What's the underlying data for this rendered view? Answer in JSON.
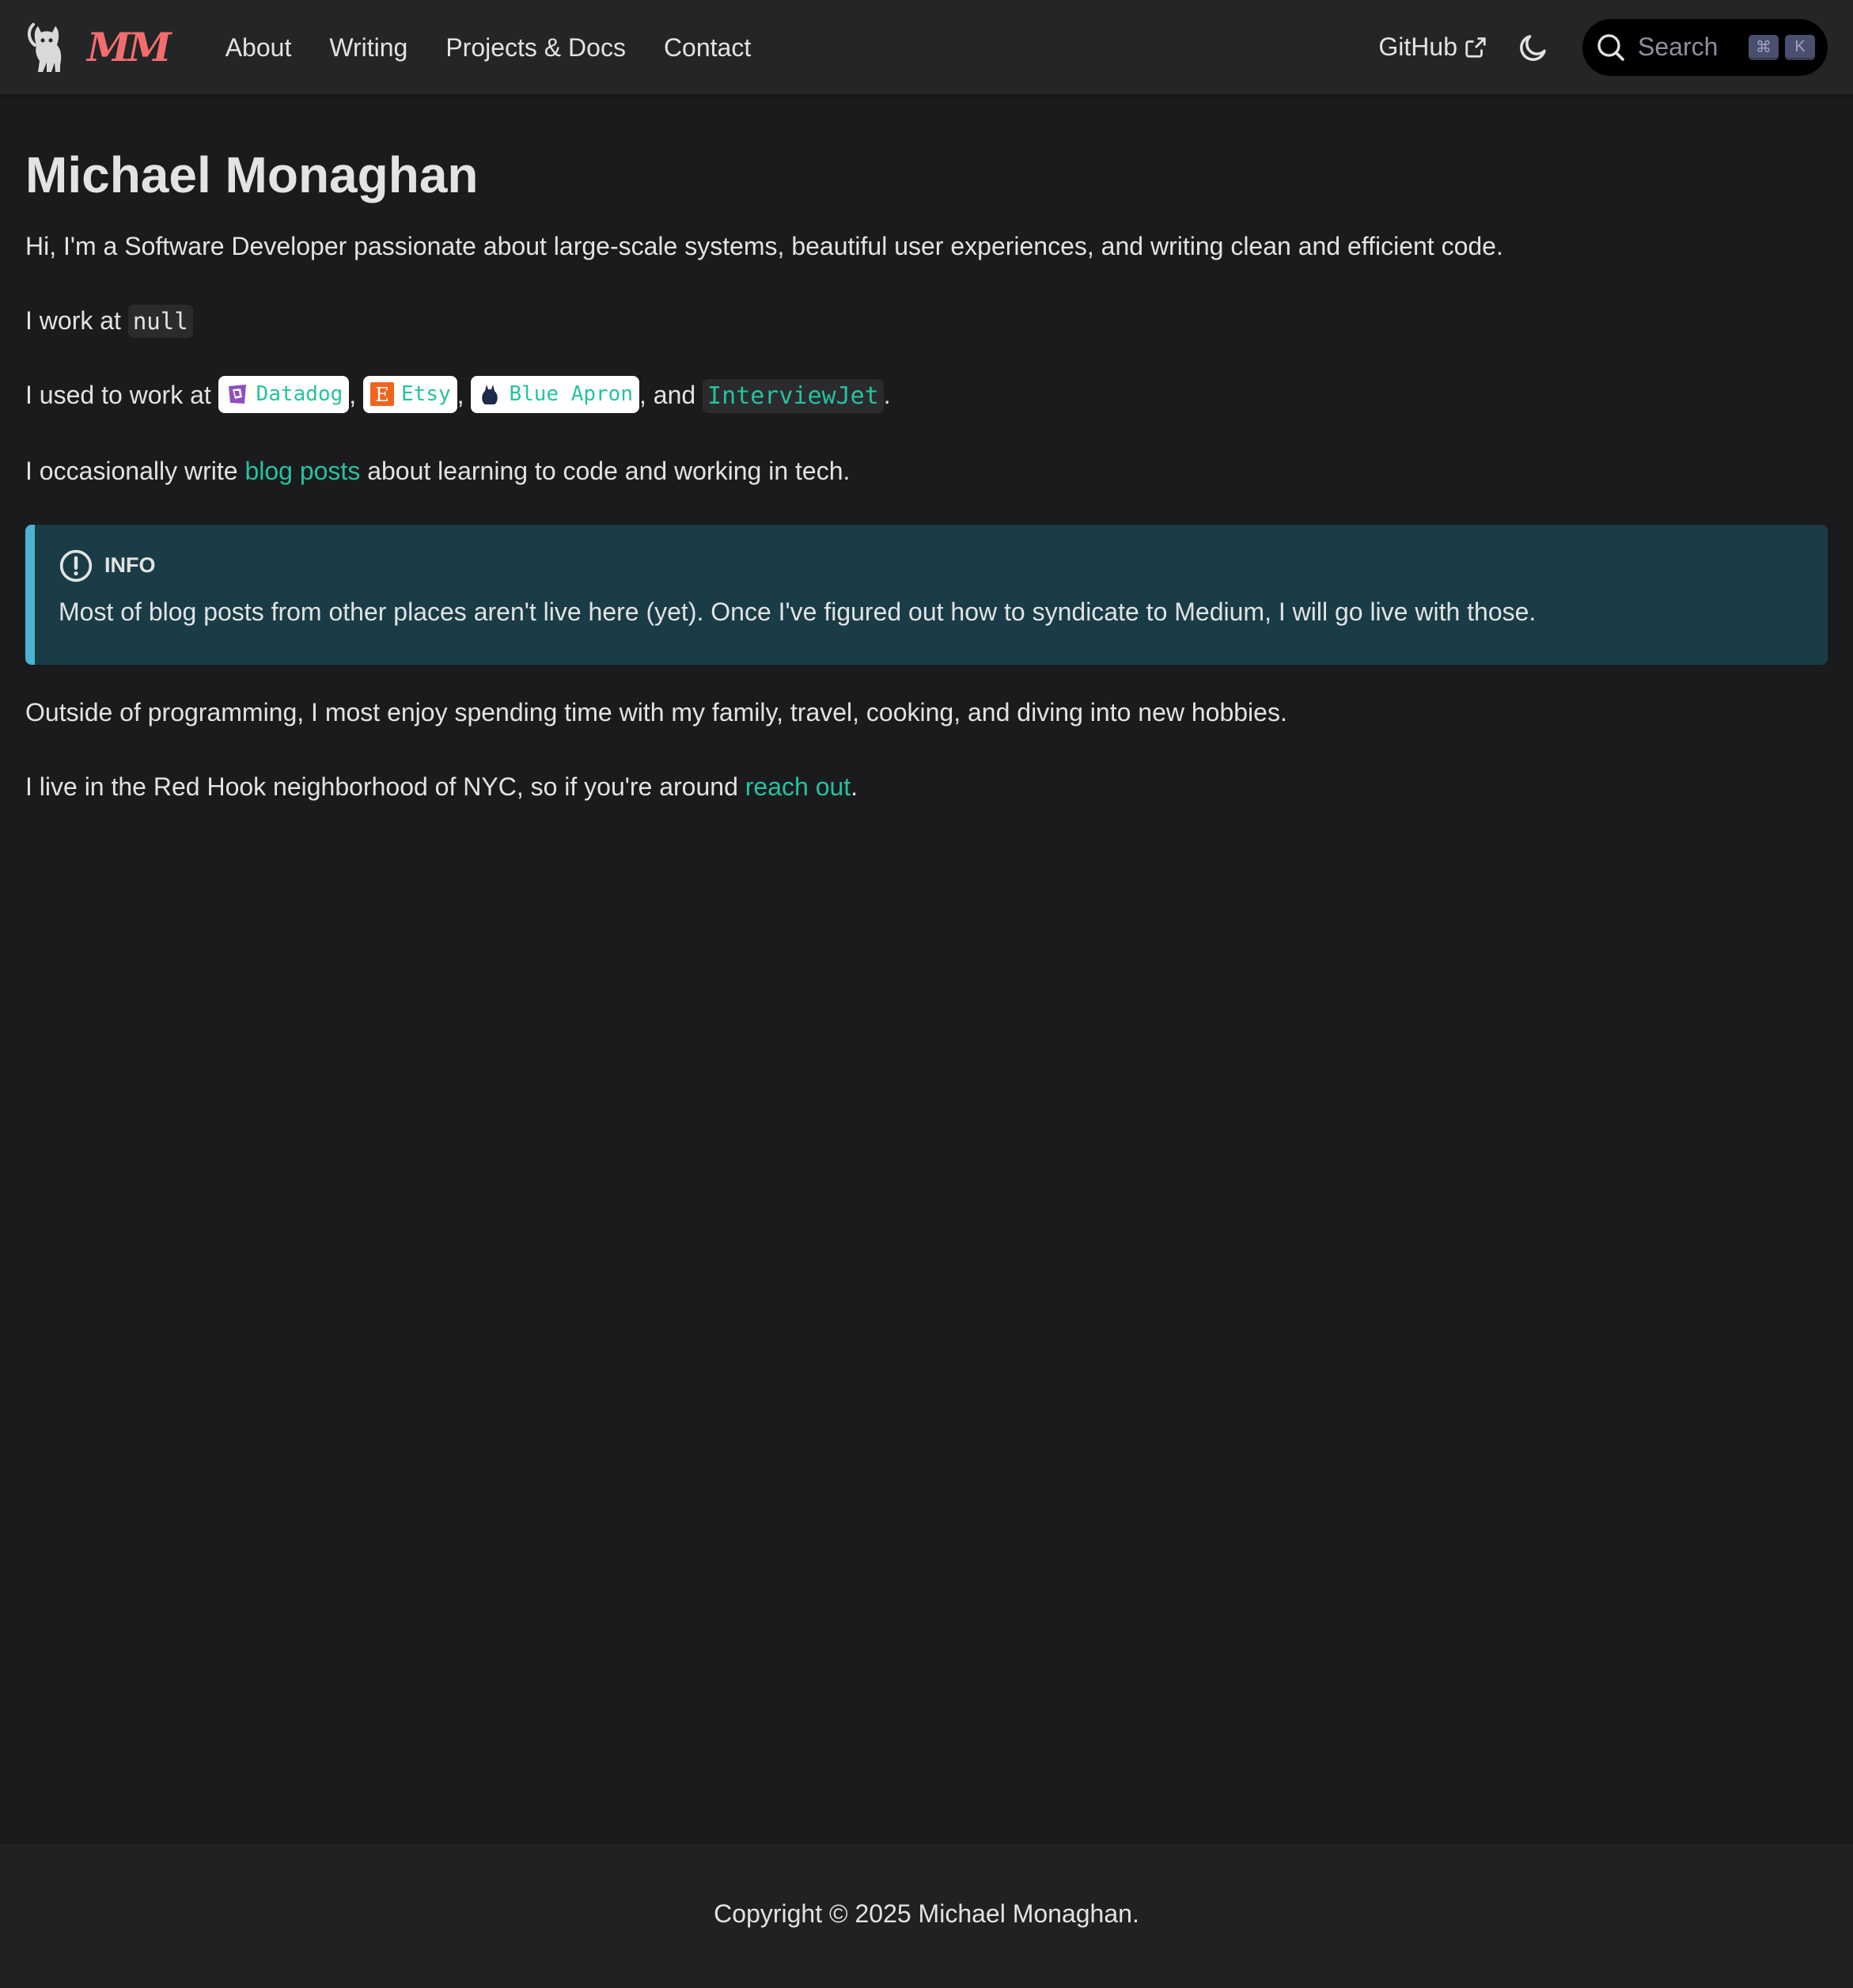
{
  "navbar": {
    "brand_monogram": "MM",
    "links": [
      "About",
      "Writing",
      "Projects & Docs",
      "Contact"
    ],
    "github_label": "GitHub",
    "search_placeholder": "Search",
    "search_keys": [
      "⌘",
      "K"
    ]
  },
  "main": {
    "title": "Michael Monaghan",
    "intro": "Hi, I'm a Software Developer passionate about large-scale systems, beautiful user experiences, and writing clean and efficient code.",
    "work_prefix": "I work at ",
    "work_current": "null",
    "past_prefix": "I used to work at ",
    "past_companies": [
      "Datadog",
      "Etsy",
      "Blue Apron",
      "InterviewJet"
    ],
    "sep_comma": ",",
    "sep_and": ", and ",
    "past_suffix": ".",
    "write_prefix": "I occasionally write ",
    "write_link": "blog posts",
    "write_suffix": " about learning to code and working in tech.",
    "info": {
      "title": "INFO",
      "body": "Most of blog posts from other places aren't live here (yet). Once I've figured out how to syndicate to Medium, I will go live with those."
    },
    "hobbies": "Outside of programming, I most enjoy spending time with my family, travel, cooking, and diving into new hobbies.",
    "location_prefix": "I live in the Red Hook neighborhood of NYC, so if you're around ",
    "location_link": "reach out",
    "location_suffix": "."
  },
  "footer": {
    "copyright": "Copyright © 2025 Michael Monaghan."
  },
  "colors": {
    "background": "#1b1b1d",
    "navbar": "#242526",
    "link": "#25c2a0",
    "brand": "#f26d6d",
    "info_bg": "#193c47",
    "info_border": "#4cb3d4"
  },
  "icons": {
    "brand": "cat-logo-icon",
    "github_external": "external-link-icon",
    "theme": "moon-icon",
    "search": "search-icon",
    "info": "exclamation-circle-icon"
  }
}
